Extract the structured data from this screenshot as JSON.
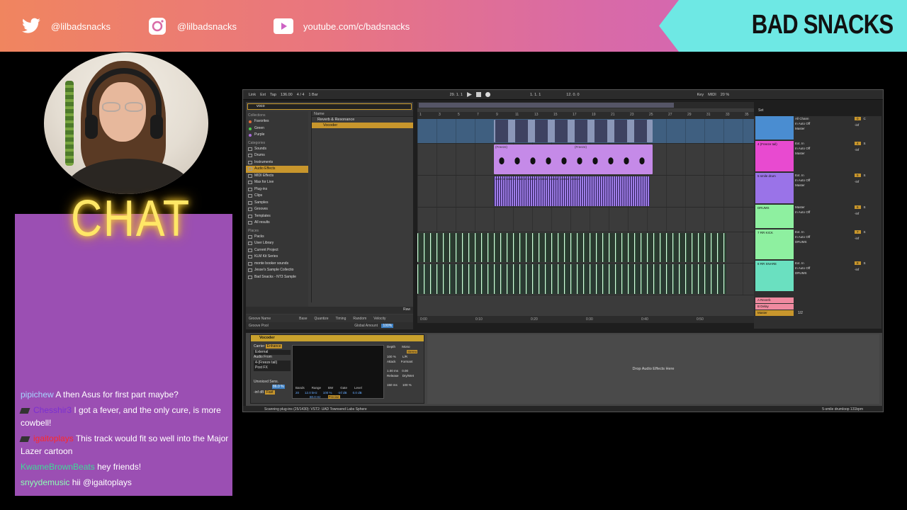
{
  "banner": {
    "twitter_handle": "@lilbadsnacks",
    "instagram_handle": "@lilbadsnacks",
    "youtube_url": "youtube.com/c/badsnacks",
    "brand": "BAD SNACKS",
    "icons": [
      "twitter-icon",
      "instagram-icon",
      "youtube-icon"
    ]
  },
  "chat": {
    "title": "CHAT",
    "messages": [
      {
        "user": "pipichew",
        "user_color": "#a6d4ff",
        "text": "A then Asus for first part maybe?"
      },
      {
        "user": "Chesshir3",
        "user_color": "#7b2fd1",
        "text": "I got a fever, and the only cure, is more cowbell!",
        "badge": true
      },
      {
        "user": "igaitoplays",
        "user_color": "#ff2828",
        "text": "This track would fit so well into the Major Lazer cartoon",
        "badge": true
      },
      {
        "user": "KwameBrownBeats",
        "user_color": "#3ddc97",
        "text": "hey friends!"
      },
      {
        "user": "snyydemusic",
        "user_color": "#8cffb4",
        "text": "hii @igaitoplays"
      }
    ]
  },
  "daw": {
    "control_bar": {
      "link": "Link",
      "ext": "Ext",
      "tap": "Tap",
      "tempo": "136.00",
      "sig": "4 / 4",
      "quant": "1 Bar",
      "position": "29. 1. 1",
      "loop_start": "1. 1. 1",
      "loop_len": "12. 0. 0",
      "key": "Key",
      "midi": "MIDI",
      "cpu": "20 %"
    },
    "browser": {
      "search_value": "voco",
      "collections_header": "Collections",
      "collections": [
        {
          "label": "Favorites",
          "color": "#e06b3a"
        },
        {
          "label": "Green",
          "color": "#4cc94c"
        },
        {
          "label": "Purple",
          "color": "#a86bd9"
        }
      ],
      "categories_header": "Categories",
      "categories": [
        "Sounds",
        "Drums",
        "Instruments",
        "Audio Effects",
        "MIDI Effects",
        "Max for Live",
        "Plug-ins",
        "Clips",
        "Samples",
        "Grooves",
        "Templates",
        "All results"
      ],
      "selected_category": "Audio Effects",
      "places_header": "Places",
      "places": [
        "Packs",
        "User Library",
        "Current Project",
        "KLM Kit Series",
        "monte booker sounds",
        "Jesse's Sample Collectio",
        "Bad Snacks - NT3 Sample"
      ],
      "name_header": "Name",
      "files": [
        "Reverb & Resonance",
        "Vocoder"
      ],
      "selected_file": "Vocoder",
      "raw": "Raw",
      "groove_cols": [
        "Groove Name",
        "Base",
        "Quantize",
        "Timing",
        "Random",
        "Velocity"
      ],
      "groove_pool": "Groove Pool",
      "global_amount_label": "Global Amount",
      "global_amount": "100%"
    },
    "ruler": [
      "1",
      "3",
      "5",
      "7",
      "9",
      "11",
      "13",
      "15",
      "17",
      "19",
      "21",
      "23",
      "25",
      "27",
      "29",
      "31",
      "33",
      "35"
    ],
    "time_ruler": [
      "0:00",
      "0:10",
      "0:20",
      "0:30",
      "0:40",
      "0:50"
    ],
    "clip_labels": {
      "freeze": "(Freeze)",
      "smile": "smile dr smile dr smile dr smile dr smile dr smile dr smile dr smile dr"
    },
    "tracks": [
      {
        "name": "",
        "color": "#4a8dd1",
        "input": "All Chann",
        "route": "Master",
        "vol": "0",
        "sc": "C"
      },
      {
        "name": "4 (Freeze tail)",
        "color": "#e84ad0",
        "input": "Ext. In",
        "route": "Master",
        "vol": "4",
        "sc": "S"
      },
      {
        "name": "5 smile drum",
        "color": "#9a73e8",
        "input": "Ext. In",
        "route": "Master",
        "vol": "5",
        "sc": "S"
      },
      {
        "name": "DRUMS",
        "color": "#8ef0a0",
        "input": "Master",
        "route": "",
        "vol": "6",
        "sc": "S"
      },
      {
        "name": "7 RR KICK",
        "color": "#8ef0a0",
        "input": "Ext. In",
        "route": "DRUMS",
        "vol": "7",
        "sc": "S"
      },
      {
        "name": "8 RR SNARE",
        "color": "#6ae0c0",
        "input": "Ext. In",
        "route": "DRUMS",
        "vol": "8",
        "sc": "S"
      }
    ],
    "returns": [
      {
        "name": "A Reverb",
        "color": "#f08aa0"
      },
      {
        "name": "B Delay",
        "color": "#f08aa0"
      },
      {
        "name": "Master",
        "color": "#c8962c",
        "value": "1/2"
      }
    ],
    "mixer_labels": {
      "set": "Set",
      "in": "In",
      "auto": "Auto",
      "off": "Off",
      "inf": "-inf"
    },
    "device": {
      "name": "Vocoder",
      "carrier_label": "Carrier",
      "carrier_mode": "Enhance",
      "carrier_value": "External",
      "audio_from_label": "Audio From",
      "audio_from_value": "4-(Freeze tail)",
      "post_fx": "Post FX",
      "unvoiced_label": "Unvoiced",
      "sens_label": "Sens.",
      "sens_value": "86.0 %",
      "unvoiced_value": "-inf dB",
      "fast": "Fast",
      "bands_label": "Bands",
      "bands": "20",
      "range_label": "Range",
      "range_low": "80.0 Hz",
      "range_high": "12.0 kHz",
      "bw_label": "BW",
      "bw": "100 %",
      "gate_label": "Gate",
      "gate": "-inf dB",
      "level_label": "Level",
      "level": "0.0 dB",
      "precise": "Precise",
      "depth_label": "Depth",
      "depth": "100 %",
      "attack_label": "Attack",
      "attack": "1.00 ms",
      "release_label": "Release",
      "release": "150 ms",
      "mono_label": "Mono",
      "stereo": "Stereo",
      "lr": "L/R",
      "formant_label": "Formant",
      "formant": "0.00",
      "drywet_label": "Dry/Wet",
      "drywet": "100 %"
    },
    "drop_text": "Drop Audio Effects Here",
    "status_text": "Scanning plug-ins (25/1430): VST2: UAD Townsend Labs Sphere",
    "status_right": "5-smile drumloop 131bpm"
  }
}
